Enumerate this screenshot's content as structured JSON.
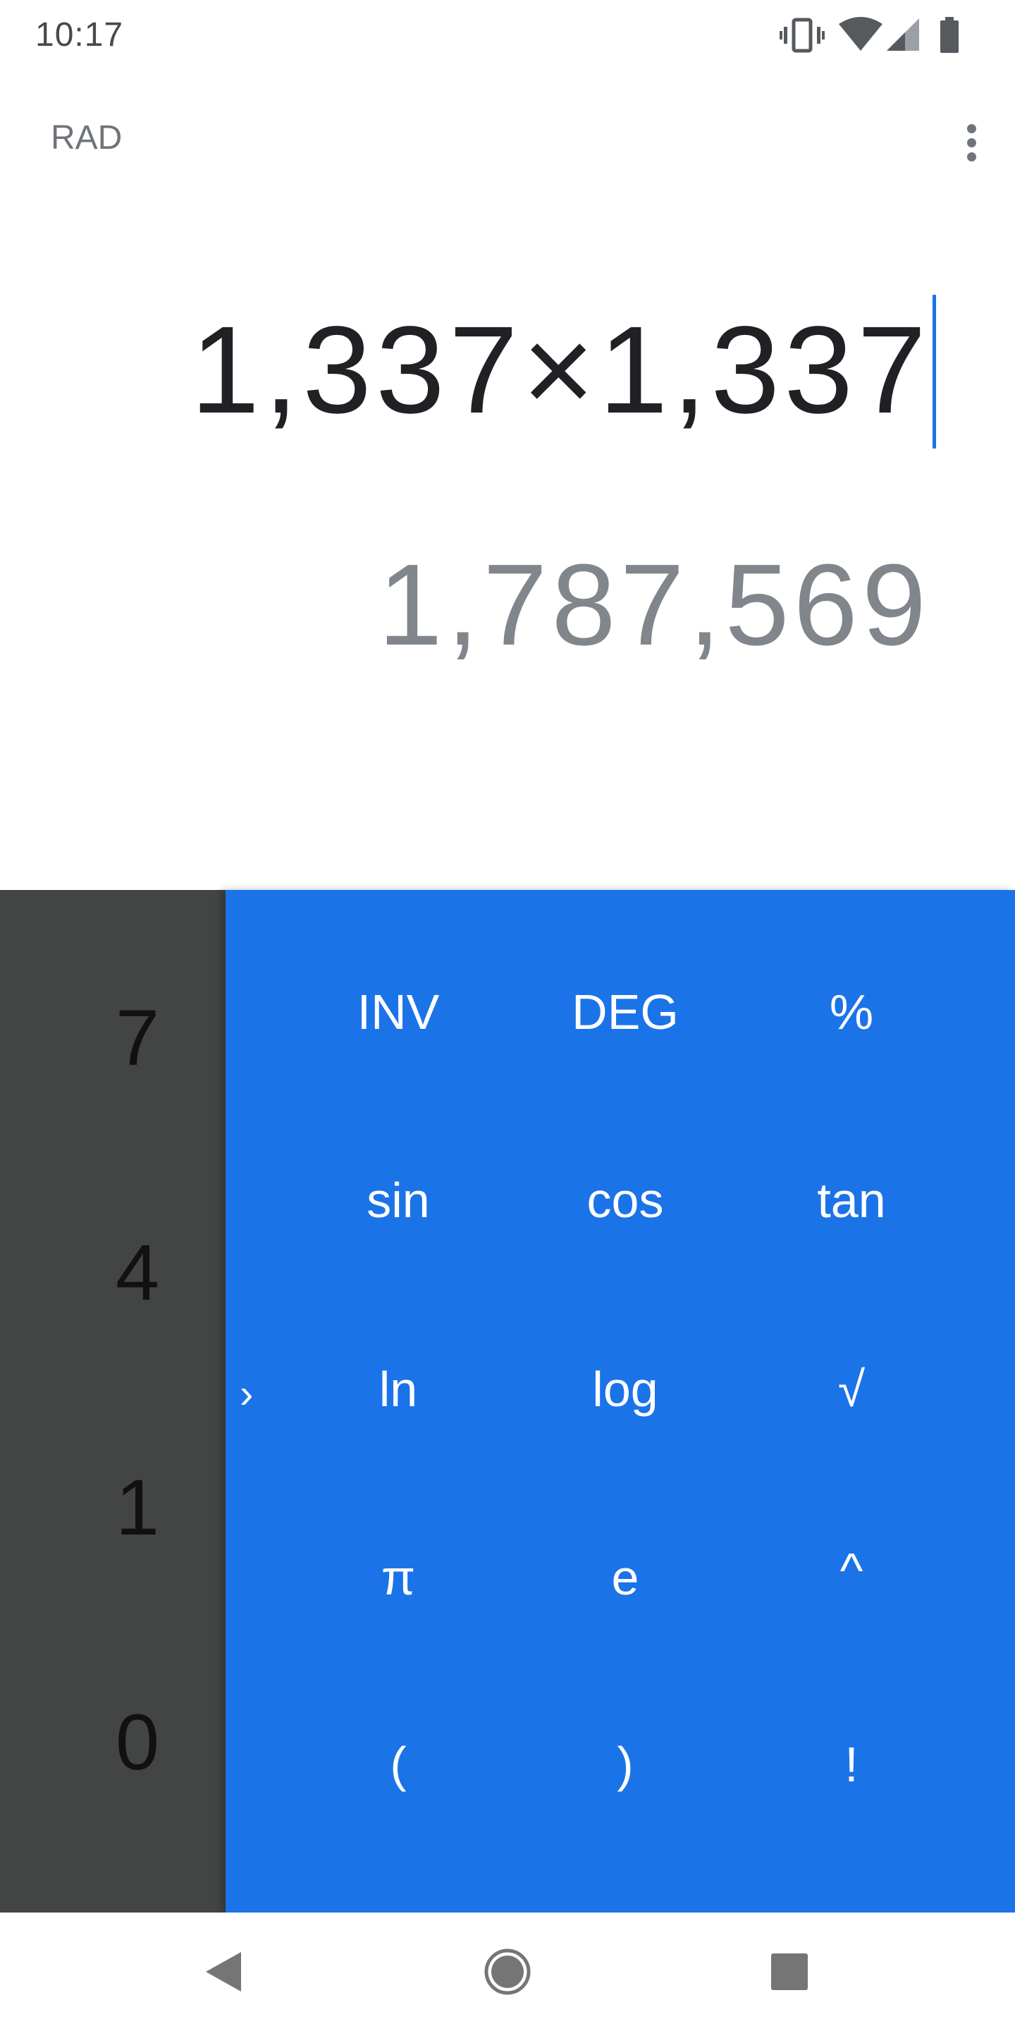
{
  "status_bar": {
    "time": "10:17",
    "icons": [
      "vibrate-icon",
      "wifi-icon",
      "cell-signal-icon",
      "battery-icon"
    ]
  },
  "top_bar": {
    "angle_mode": "RAD",
    "menu_icon": "more-vert-icon"
  },
  "display": {
    "formula": "1,337×1,337",
    "result": "1,787,569"
  },
  "digit_pad": {
    "keys": [
      "7",
      "4",
      "1",
      "0"
    ]
  },
  "advanced_pad": {
    "collapse_icon": "chevron-right-icon",
    "rows": [
      [
        "INV",
        "DEG",
        "%"
      ],
      [
        "sin",
        "cos",
        "tan"
      ],
      [
        "ln",
        "log",
        "√"
      ],
      [
        "π",
        "e",
        "^"
      ],
      [
        "(",
        ")",
        "!"
      ]
    ]
  },
  "nav_bar": {
    "buttons": [
      "back-icon",
      "home-icon",
      "recents-icon"
    ]
  },
  "colors": {
    "accent": "#1b73e8",
    "digit_pad_bg": "#434545",
    "formula_text": "#202124",
    "result_text": "#81868d"
  }
}
